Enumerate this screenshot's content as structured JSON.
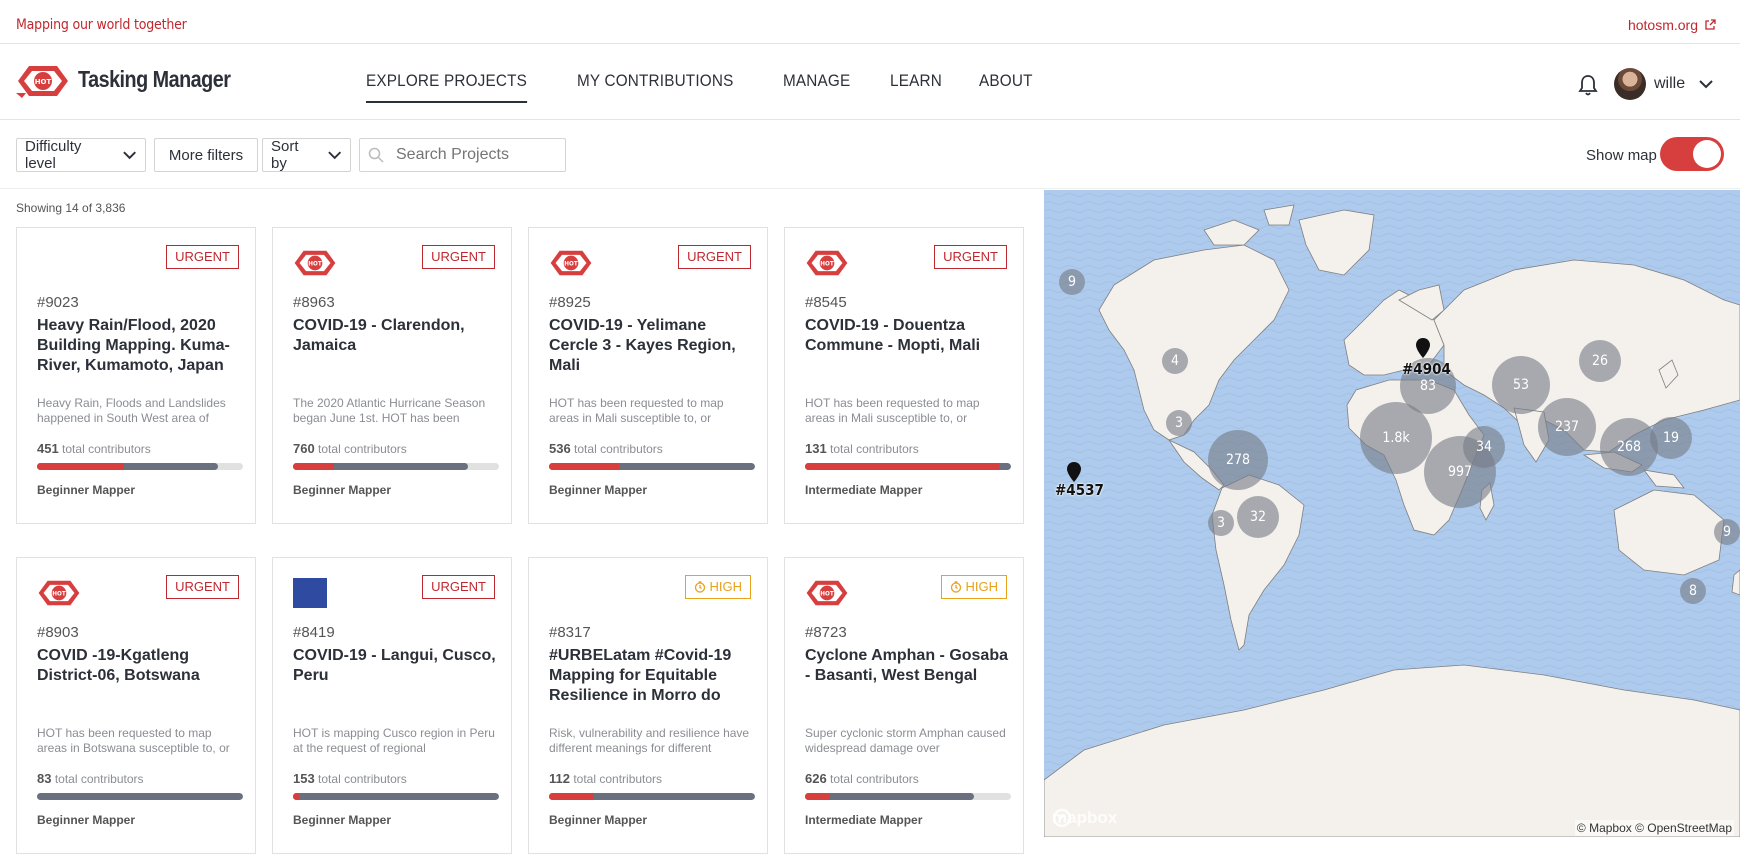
{
  "top": {
    "tagline": "Mapping our world together",
    "external_link": "hotosm.org"
  },
  "header": {
    "brand": "Tasking Manager",
    "logo_text": "HOT",
    "nav": [
      {
        "label": "EXPLORE PROJECTS",
        "active": true
      },
      {
        "label": "MY CONTRIBUTIONS",
        "active": false
      },
      {
        "label": "MANAGE",
        "active": false
      },
      {
        "label": "LEARN",
        "active": false
      },
      {
        "label": "ABOUT",
        "active": false
      }
    ],
    "username": "wille",
    "icons": {
      "bell": "bell-icon",
      "user_menu": "chevron-down-icon",
      "external": "external-link-icon"
    }
  },
  "filters": {
    "difficulty": "Difficulty level",
    "more": "More filters",
    "sort": "Sort by",
    "search_placeholder": "Search Projects",
    "show_map_label": "Show map",
    "show_map_on": true
  },
  "results": {
    "showing": "Showing 14 of 3,836"
  },
  "projects": [
    {
      "id": "#9023",
      "priority": "URGENT",
      "logo": "none",
      "title": "Heavy Rain/Flood, 2020 Building Mapping. Kuma-River, Kumamoto, Japan",
      "desc": "Heavy Rain, Floods and Landslides happened in South West area of",
      "contributors": "451",
      "contrib_label": "total contributors",
      "mapped": 0.88,
      "validated": 0.42,
      "level": "Beginner Mapper"
    },
    {
      "id": "#8963",
      "priority": "URGENT",
      "logo": "hot",
      "title": "COVID-19 - Clarendon, Jamaica",
      "desc": "The 2020 Atlantic Hurricane Season began June 1st. HOT has been",
      "contributors": "760",
      "contrib_label": "total contributors",
      "mapped": 0.85,
      "validated": 0.2,
      "level": "Beginner Mapper"
    },
    {
      "id": "#8925",
      "priority": "URGENT",
      "logo": "hot",
      "title": "COVID-19 - Yelimane Cercle 3 - Kayes Region, Mali",
      "desc": "HOT has been requested to map areas in Mali susceptible to, or",
      "contributors": "536",
      "contrib_label": "total contributors",
      "mapped": 1.0,
      "validated": 0.34,
      "level": "Beginner Mapper"
    },
    {
      "id": "#8545",
      "priority": "URGENT",
      "logo": "hot",
      "title": "COVID-19 - Douentza Commune - Mopti, Mali",
      "desc": "HOT has been requested to map areas in Mali susceptible to, or",
      "contributors": "131",
      "contrib_label": "total contributors",
      "mapped": 1.0,
      "validated": 0.94,
      "level": "Intermediate Mapper"
    },
    {
      "id": "#8903",
      "priority": "URGENT",
      "logo": "hot",
      "title": "COVID -19-Kgatleng District-06, Botswana",
      "desc": "HOT has been requested to map areas in Botswana susceptible to, or",
      "contributors": "83",
      "contrib_label": "total contributors",
      "mapped": 1.0,
      "validated": 0.0,
      "level": "Beginner Mapper"
    },
    {
      "id": "#8419",
      "priority": "URGENT",
      "logo": "square",
      "title": "COVID-19 - Langui, Cusco, Peru",
      "desc": "HOT is mapping Cusco region in Peru at the request of regional",
      "contributors": "153",
      "contrib_label": "total contributors",
      "mapped": 1.0,
      "validated": 0.03,
      "level": "Beginner Mapper"
    },
    {
      "id": "#8317",
      "priority": "HIGH",
      "logo": "none",
      "title": "#URBELatam #Covid-19 Mapping for Equitable Resilience in Morro do",
      "desc": "Risk, vulnerability and resilience have different meanings for different",
      "contributors": "112",
      "contrib_label": "total contributors",
      "mapped": 1.0,
      "validated": 0.22,
      "level": "Beginner Mapper"
    },
    {
      "id": "#8723",
      "priority": "HIGH",
      "logo": "hot",
      "title": "Cyclone Amphan - Gosaba - Basanti, West Bengal",
      "desc": "Super cyclonic storm Amphan caused widespread damage over",
      "contributors": "626",
      "contrib_label": "total contributors",
      "mapped": 0.82,
      "validated": 0.12,
      "level": "Intermediate Mapper"
    }
  ],
  "map": {
    "clusters": [
      "9",
      "4",
      "3",
      "278",
      "3",
      "32",
      "83",
      "1.8k",
      "34",
      "997",
      "53",
      "26",
      "237",
      "268",
      "19",
      "9",
      "8"
    ],
    "pins": [
      "#4904",
      "#4537"
    ],
    "logo": "mapbox",
    "attribution": "© Mapbox © OpenStreetMap"
  },
  "colors": {
    "accent": "#d73f3f",
    "high": "#e8a21b",
    "mapped_bar": "#6a707e",
    "water": "#aecbed",
    "land": "#f4f1ec"
  }
}
